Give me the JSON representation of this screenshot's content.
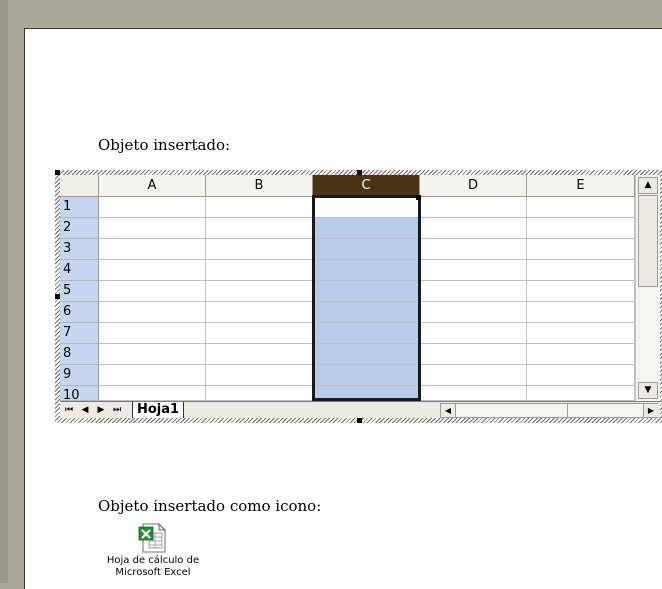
{
  "document": {
    "label_inserted": "Objeto insertado:",
    "label_inserted_icon": "Objeto insertado como icono:"
  },
  "sheet": {
    "columns": [
      "A",
      "B",
      "C",
      "D",
      "E"
    ],
    "rows": [
      "1",
      "2",
      "3",
      "4",
      "5",
      "6",
      "7",
      "8",
      "9",
      "10"
    ],
    "selected_column": "C",
    "tab_name": "Hoja1"
  },
  "icon_object": {
    "icon": "excel-file-icon",
    "caption_line1": "Hoja de cálculo de",
    "caption_line2": "Microsoft Excel"
  },
  "colors": {
    "selected_header": "#4a3414",
    "selection_fill": "#b9cbe8",
    "row_header": "#c6d6f0",
    "desktop": "#aca899"
  }
}
